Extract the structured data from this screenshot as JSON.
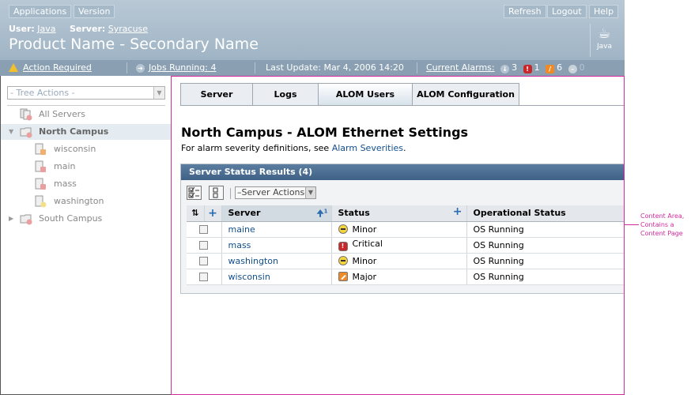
{
  "masthead": {
    "buttons": {
      "applications": "Applications",
      "version": "Version",
      "refresh": "Refresh",
      "logout": "Logout",
      "help": "Help"
    },
    "user_label": "User:",
    "user_value": "Java",
    "server_label": "Server:",
    "server_value": "Syracuse",
    "product_name": "Product Name - Secondary Name",
    "logo_text": "Java",
    "colors": {
      "masthead_bg": "#a9bccc",
      "status_bg": "#8aa0b2"
    }
  },
  "statusbar": {
    "action_required": "Action Required",
    "jobs_running": "Jobs Running: 4",
    "last_update": "Last Update: Mar 4, 2006 14:20",
    "current_alarms": "Current Alarms:",
    "alarms": {
      "down": "3",
      "critical": "1",
      "major": "6",
      "minor": "0"
    }
  },
  "tree": {
    "actions_placeholder": "- Tree Actions -",
    "items": [
      {
        "label": "All Servers"
      },
      {
        "label": "North Campus"
      },
      {
        "label": "wisconsin"
      },
      {
        "label": "main"
      },
      {
        "label": "mass"
      },
      {
        "label": "washington"
      },
      {
        "label": "South Campus"
      }
    ]
  },
  "content": {
    "tabs": [
      "Server",
      "Logs",
      "ALOM Users",
      "ALOM Configuration"
    ],
    "active_tab": "ALOM Users",
    "page_title": "North Campus - ALOM Ethernet Settings",
    "help_prefix": "For alarm severity definitions, see ",
    "help_link": "Alarm Severities",
    "help_suffix": ".",
    "table": {
      "title": "Server Status Results (4)",
      "server_actions": "–Server Actions–",
      "sort_indicator": "1",
      "columns": {
        "server": "Server",
        "status": "Status",
        "op_status": "Operational Status"
      },
      "rows": [
        {
          "server": "maine",
          "status": "Minor",
          "op_status": "OS Running"
        },
        {
          "server": "mass",
          "status": "Critical",
          "op_status": "OS Running"
        },
        {
          "server": "washington",
          "status": "Minor",
          "op_status": "OS Running"
        },
        {
          "server": "wisconsin",
          "status": "Major",
          "op_status": "OS Running"
        }
      ]
    }
  },
  "annotation": {
    "line1": "Content Area,",
    "line2": "Contains a",
    "line3": "Content Page",
    "color": "#d42a9c"
  }
}
